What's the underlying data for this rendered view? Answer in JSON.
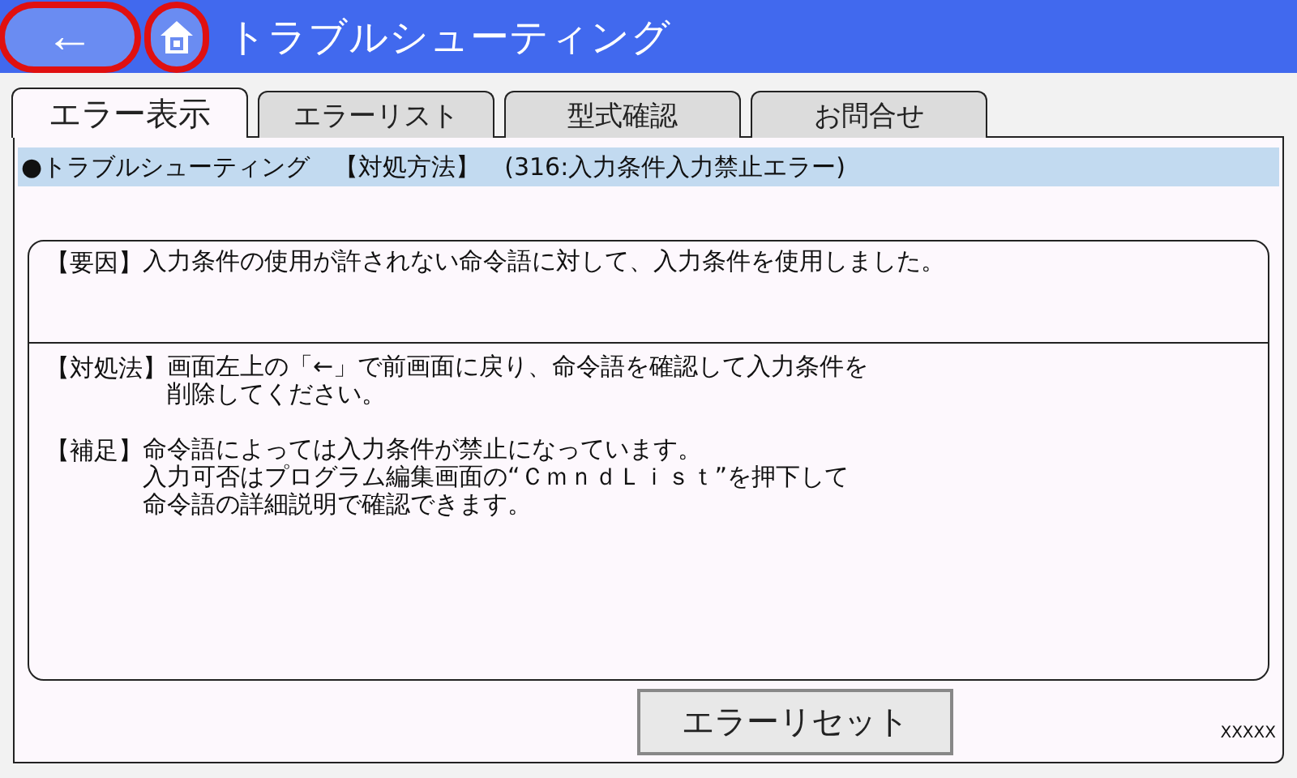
{
  "header": {
    "back_button": {
      "label": "←",
      "highlighted": true
    },
    "home_button": {
      "highlighted": true
    },
    "title": "トラブルシューティング"
  },
  "tabs": [
    {
      "label": "エラー表示",
      "selected": true
    },
    {
      "label": "エラーリスト",
      "selected": false
    },
    {
      "label": "型式確認",
      "selected": false
    },
    {
      "label": "お問合せ",
      "selected": false
    }
  ],
  "info_bar": "●トラブルシューティング　【対処方法】　(316:入力条件入力禁止エラー)",
  "cause": {
    "label": "【要因】",
    "lines": [
      "入力条件の使用が許されない命令語に対して、入力条件を使用しました。"
    ]
  },
  "remedies": [
    {
      "label": "【対処法】",
      "lines": [
        "画面左上の「←」で前画面に戻り、命令語を確認して入力条件を",
        "削除してください。"
      ]
    },
    {
      "label": "【補足】",
      "lines": [
        "命令語によっては入力条件が禁止になっています。",
        "入力可否はプログラム編集画面の“ＣｍｎｄＬｉｓｔ”を押下して",
        "命令語の詳細説明で確認できます。"
      ]
    }
  ],
  "reset_button": "エラーリセット",
  "footer_code": "XXXXX"
}
